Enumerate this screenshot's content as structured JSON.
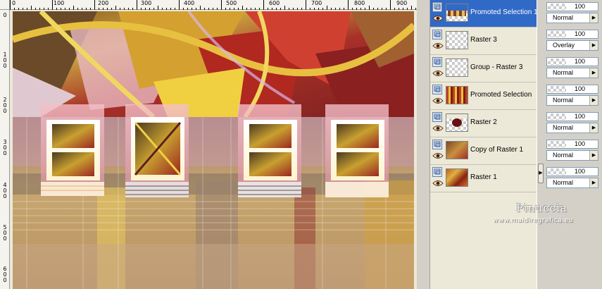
{
  "ruler": {
    "top_labels": [
      "0",
      "100",
      "200",
      "300",
      "400",
      "500",
      "600",
      "700",
      "800",
      "900"
    ],
    "left_labels": [
      "0",
      "1\n0\n0",
      "2\n0\n0",
      "3\n0\n0",
      "4\n0\n0",
      "5\n0\n0",
      "6\n0\n0"
    ]
  },
  "layers": [
    {
      "name": "Promoted Selection 1",
      "selected": true,
      "opacity": "100",
      "mode": "Normal"
    },
    {
      "name": "Raster 3",
      "selected": false,
      "opacity": "100",
      "mode": "Overlay"
    },
    {
      "name": "Group - Raster 3",
      "selected": false,
      "opacity": "100",
      "mode": "Normal"
    },
    {
      "name": "Promoted Selection",
      "selected": false,
      "opacity": "100",
      "mode": "Normal"
    },
    {
      "name": "Raster 2",
      "selected": false,
      "opacity": "100",
      "mode": "Normal"
    },
    {
      "name": "Copy of Raster 1",
      "selected": false,
      "opacity": "100",
      "mode": "Normal"
    },
    {
      "name": "Raster 1",
      "selected": false,
      "opacity": "100",
      "mode": "Normal"
    }
  ],
  "watermark": {
    "name": "Pinuccia",
    "url": "www.maidiregrafica.eu"
  },
  "icons": {
    "visibility": "layer-visibility-icon",
    "eye": "eye-icon",
    "splitter": "triangle-right-icon",
    "dropdown": "triangle-right-icon"
  },
  "colors": {
    "selection": "#3169c6",
    "panel": "#ece9d8"
  }
}
